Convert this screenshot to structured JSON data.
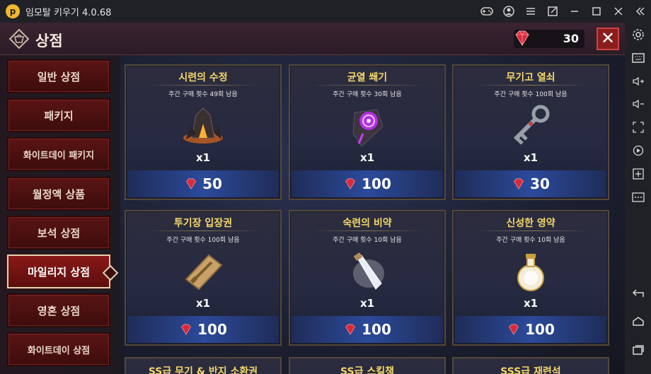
{
  "window": {
    "title": "임모탈 키우기 4.0.68",
    "logo_letter": "p",
    "controls": [
      "gamepad-icon",
      "account-icon",
      "menu-icon",
      "popout-icon",
      "minimize-icon",
      "maximize-icon",
      "close-icon",
      "collapse-icon"
    ]
  },
  "side_panel": {
    "buttons": [
      "settings-icon",
      "keyboard-icon",
      "volume-up-icon",
      "volume-down-icon",
      "screenshot-icon",
      "record-icon",
      "add-instance-icon",
      "more-icon",
      "back-icon",
      "home-icon",
      "recent-apps-icon"
    ]
  },
  "shop": {
    "title": "상점",
    "currency_value": "30",
    "close_label": "✕",
    "gem_color": "#d82a3a"
  },
  "menu": {
    "items": [
      {
        "label": "일반 상점"
      },
      {
        "label": "패키지"
      },
      {
        "label": "화이트데이 패키지"
      },
      {
        "label": "월정액 상품"
      },
      {
        "label": "보석 상점"
      },
      {
        "label": "마일리지 상점"
      },
      {
        "label": "영혼 상점"
      },
      {
        "label": "화이트데이 상점"
      }
    ],
    "active_index": 5
  },
  "cards": [
    {
      "name": "시련의 수정",
      "limit": "주간 구매 횟수 49회 남음",
      "qty": "x1",
      "price": "50",
      "icon": "crystal-icon"
    },
    {
      "name": "균열 쐐기",
      "limit": "주간 구매 횟수 30회 남음",
      "qty": "x1",
      "price": "100",
      "icon": "rift-wedge-icon"
    },
    {
      "name": "무기고 열쇠",
      "limit": "주간 구매 횟수 100회 남음",
      "qty": "x1",
      "price": "30",
      "icon": "key-icon"
    },
    {
      "name": "투기장 입장권",
      "limit": "주간 구매 횟수 100회 남음",
      "qty": "x1",
      "price": "100",
      "icon": "ticket-icon"
    },
    {
      "name": "숙련의 비약",
      "limit": "주간 구매 횟수 10회 남음",
      "qty": "x1",
      "price": "100",
      "icon": "vial-icon"
    },
    {
      "name": "신성한 영약",
      "limit": "주간 구매 횟수 10회 남음",
      "qty": "x1",
      "price": "100",
      "icon": "flask-icon"
    }
  ],
  "partial_cards": [
    {
      "name": "SS급 무기 & 반지 소환권"
    },
    {
      "name": "SS급 스킬책"
    },
    {
      "name": "SSS급 재련석"
    }
  ]
}
